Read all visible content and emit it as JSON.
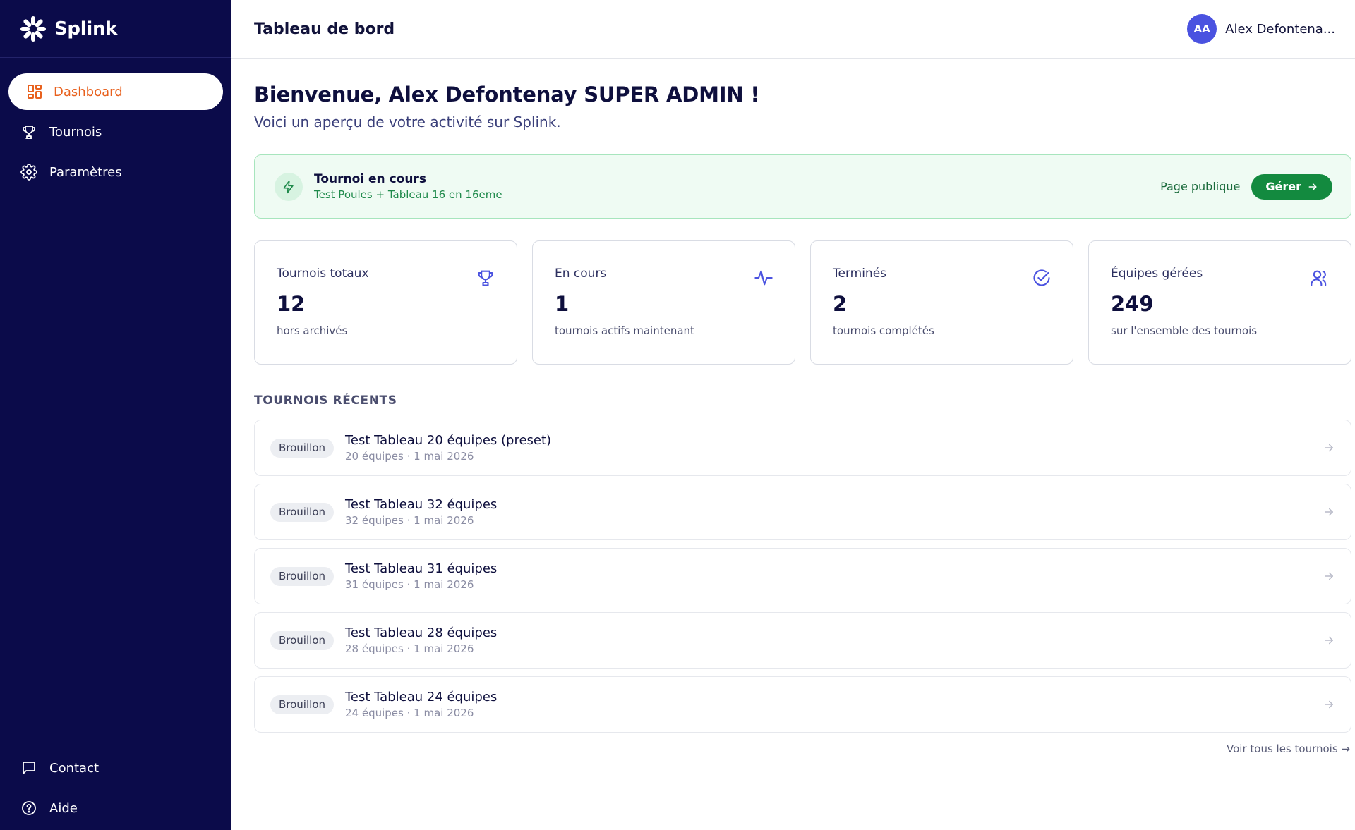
{
  "brand": {
    "name": "Splink"
  },
  "sidebar": {
    "items": [
      {
        "label": "Dashboard",
        "icon": "dashboard-grid-icon",
        "active": true
      },
      {
        "label": "Tournois",
        "icon": "trophy-icon"
      },
      {
        "label": "Paramètres",
        "icon": "gear-icon"
      }
    ],
    "bottom": [
      {
        "label": "Contact",
        "icon": "message-icon"
      },
      {
        "label": "Aide",
        "icon": "help-icon"
      }
    ]
  },
  "header": {
    "title": "Tableau de bord",
    "user_initials": "AA",
    "user_name": "Alex Defontena..."
  },
  "welcome": {
    "title": "Bienvenue, Alex Defontenay SUPER ADMIN !",
    "subtitle": "Voici un aperçu de votre activité sur Splink."
  },
  "live": {
    "title": "Tournoi en cours",
    "subtitle": "Test Poules + Tableau 16 en 16eme",
    "public_link": "Page publique",
    "manage_label": "Gérer"
  },
  "stats": [
    {
      "label": "Tournois totaux",
      "value": "12",
      "desc": "hors archivés",
      "icon": "trophy-icon"
    },
    {
      "label": "En cours",
      "value": "1",
      "desc": "tournois actifs maintenant",
      "icon": "activity-icon"
    },
    {
      "label": "Terminés",
      "value": "2",
      "desc": "tournois complétés",
      "icon": "check-circle-icon"
    },
    {
      "label": "Équipes gérées",
      "value": "249",
      "desc": "sur l'ensemble des tournois",
      "icon": "users-icon"
    }
  ],
  "recent": {
    "title": "TOURNOIS RÉCENTS",
    "items": [
      {
        "badge": "Brouillon",
        "title": "Test Tableau 20 équipes (preset)",
        "meta": "20 équipes · 1 mai 2026"
      },
      {
        "badge": "Brouillon",
        "title": "Test Tableau 32 équipes",
        "meta": "32 équipes · 1 mai 2026"
      },
      {
        "badge": "Brouillon",
        "title": "Test Tableau 31 équipes",
        "meta": "31 équipes · 1 mai 2026"
      },
      {
        "badge": "Brouillon",
        "title": "Test Tableau 28 équipes",
        "meta": "28 équipes · 1 mai 2026"
      },
      {
        "badge": "Brouillon",
        "title": "Test Tableau 24 équipes",
        "meta": "24 équipes · 1 mai 2026"
      }
    ],
    "see_all": "Voir tous les tournois →"
  },
  "colors": {
    "sidebar_bg": "#0b0b4a",
    "accent_orange": "#e8611e",
    "success_green": "#138a3f",
    "stat_icon": "#4a52e0"
  }
}
